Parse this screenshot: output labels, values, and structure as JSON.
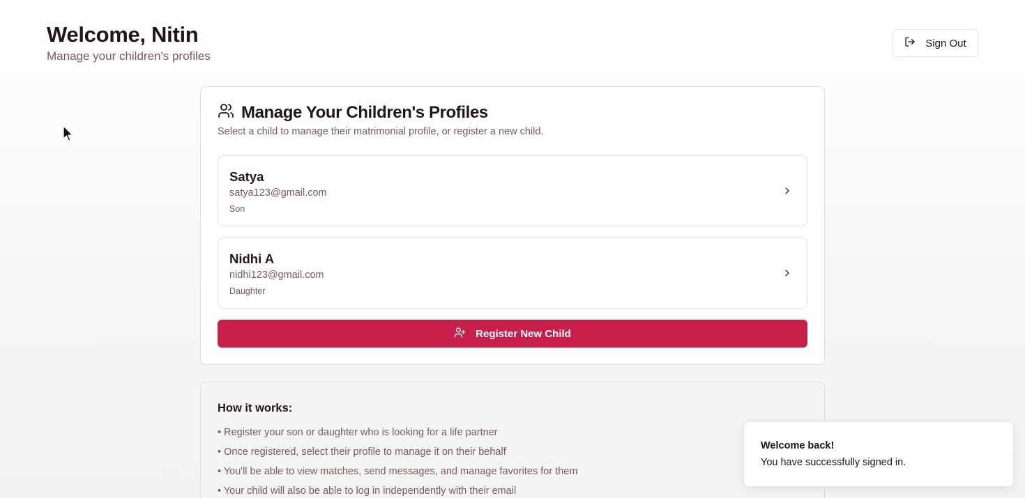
{
  "header": {
    "title": "Welcome, Nitin",
    "subtitle": "Manage your children's profiles",
    "signout_label": "Sign Out",
    "signout_icon": "log-out-icon"
  },
  "card": {
    "title": "Manage Your Children's Profiles",
    "title_icon": "users-icon",
    "description": "Select a child to manage their matrimonial profile, or register a new child.",
    "children": [
      {
        "name": "Satya",
        "email": "satya123@gmail.com",
        "relation": "Son"
      },
      {
        "name": "Nidhi A",
        "email": "nidhi123@gmail.com",
        "relation": "Daughter"
      }
    ],
    "register_label": "Register New Child",
    "register_icon": "user-plus-icon"
  },
  "how": {
    "title": "How it works:",
    "items": [
      "• Register your son or daughter who is looking for a life partner",
      "• Once registered, select their profile to manage it on their behalf",
      "• You'll be able to view matches, send messages, and manage favorites for them",
      "• Your child will also be able to log in independently with their email"
    ]
  },
  "toast": {
    "title": "Welcome back!",
    "message": "You have successfully signed in."
  },
  "colors": {
    "accent": "#c81e4a",
    "text": "#221717",
    "muted": "#7a5a5a",
    "border": "#e4dede"
  }
}
